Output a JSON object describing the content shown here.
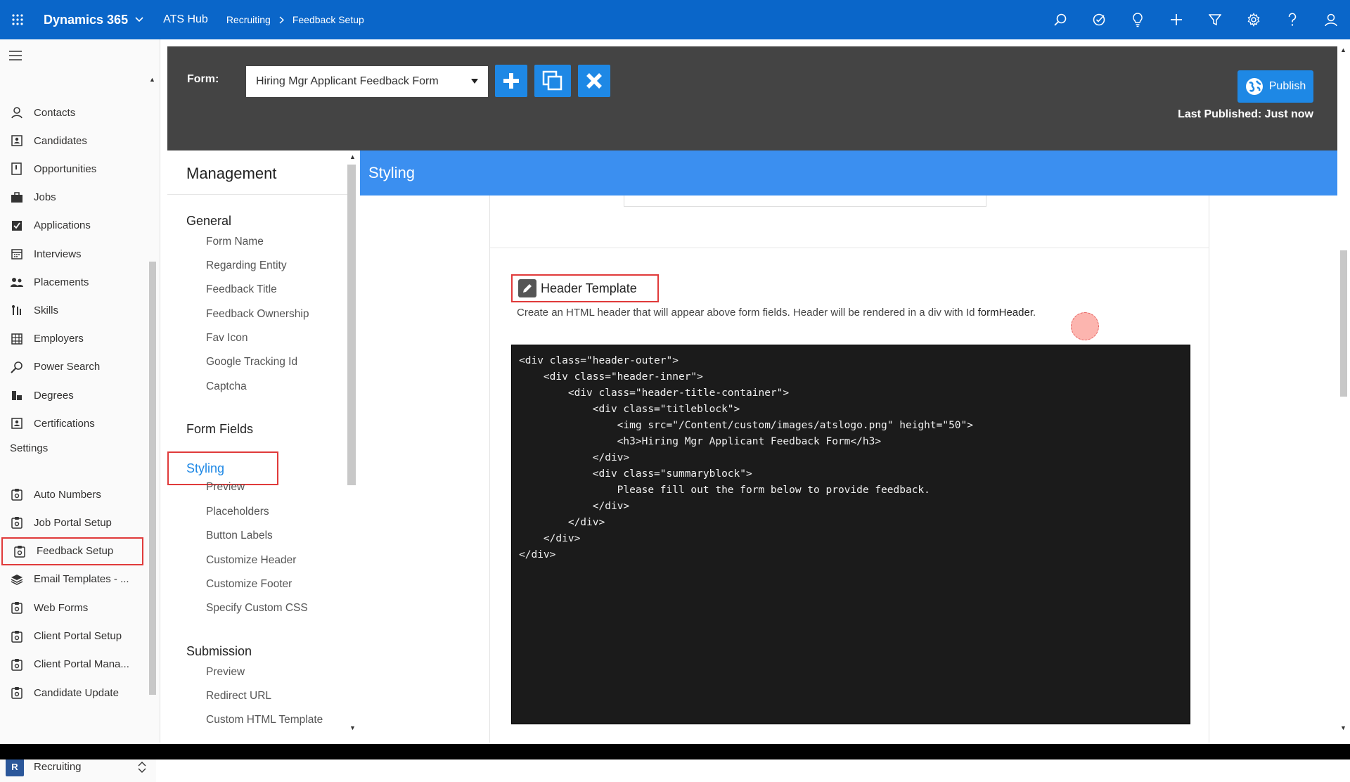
{
  "topbar": {
    "app_name": "Dynamics 365",
    "hub": "ATS Hub",
    "breadcrumb": [
      "Recruiting",
      "Feedback Setup"
    ]
  },
  "leftnav": {
    "items": [
      {
        "label": "Contacts",
        "icon": "person-icon"
      },
      {
        "label": "Candidates",
        "icon": "contact-card-icon"
      },
      {
        "label": "Opportunities",
        "icon": "opportunity-icon"
      },
      {
        "label": "Jobs",
        "icon": "briefcase-icon"
      },
      {
        "label": "Applications",
        "icon": "checkbox-icon"
      },
      {
        "label": "Interviews",
        "icon": "calendar-icon"
      },
      {
        "label": "Placements",
        "icon": "people-icon"
      },
      {
        "label": "Skills",
        "icon": "skills-icon"
      },
      {
        "label": "Employers",
        "icon": "building-icon"
      },
      {
        "label": "Power Search",
        "icon": "search-key-icon"
      },
      {
        "label": "Degrees",
        "icon": "degree-icon"
      },
      {
        "label": "Certifications",
        "icon": "certificate-icon"
      }
    ],
    "settings_heading": "Settings",
    "settings_items": [
      {
        "label": "Auto Numbers",
        "icon": "clipboard-icon"
      },
      {
        "label": "Job Portal Setup",
        "icon": "clipboard-icon"
      },
      {
        "label": "Feedback Setup",
        "icon": "clipboard-icon"
      },
      {
        "label": "Email Templates - ...",
        "icon": "layers-icon"
      },
      {
        "label": "Web Forms",
        "icon": "clipboard-icon"
      },
      {
        "label": "Client Portal Setup",
        "icon": "clipboard-icon"
      },
      {
        "label": "Client Portal Mana...",
        "icon": "clipboard-icon"
      },
      {
        "label": "Candidate Update",
        "icon": "clipboard-icon"
      }
    ],
    "area": {
      "badge": "R",
      "label": "Recruiting"
    }
  },
  "formbar": {
    "label": "Form:",
    "selected_form": "Hiring Mgr Applicant Feedback Form",
    "publish_label": "Publish",
    "last_published": "Last Published: Just now"
  },
  "management": {
    "title": "Management",
    "sections": [
      {
        "heading": "General",
        "items": [
          "Form Name",
          "Regarding Entity",
          "Feedback Title",
          "Feedback Ownership",
          "Fav Icon",
          "Google Tracking Id",
          "Captcha"
        ]
      },
      {
        "heading": "Form Fields",
        "items": []
      },
      {
        "heading": "Styling",
        "items": [
          "Preview",
          "Placeholders",
          "Button Labels",
          "Customize Header",
          "Customize Footer",
          "Specify Custom CSS"
        ]
      },
      {
        "heading": "Submission",
        "items": [
          "Preview",
          "Redirect URL",
          "Custom HTML Template"
        ]
      }
    ]
  },
  "main": {
    "section_title": "Styling",
    "header_template": {
      "title": "Header Template",
      "description_prefix": "Create an HTML header that will appear above form fields. Header will be rendered in a div with Id ",
      "description_id": "formHeader",
      "description_suffix": ".",
      "code_lines": [
        "<div class=\"header-outer\">",
        "    <div class=\"header-inner\">",
        "        <div class=\"header-title-container\">",
        "            <div class=\"titleblock\">",
        "                <img src=\"/Content/custom/images/atslogo.png\" height=\"50\">",
        "                <h3>Hiring Mgr Applicant Feedback Form</h3>",
        "            </div>",
        "            <div class=\"summaryblock\">",
        "                Please fill out the form below to provide feedback.",
        "            </div>",
        "        </div>",
        "    </div>",
        "</div>"
      ]
    }
  },
  "colors": {
    "topbar": "#0a66c9",
    "accent": "#1e88e5",
    "styling_bar": "#3b8ff0",
    "highlight": "#e03a3a",
    "formbar": "#444444"
  }
}
